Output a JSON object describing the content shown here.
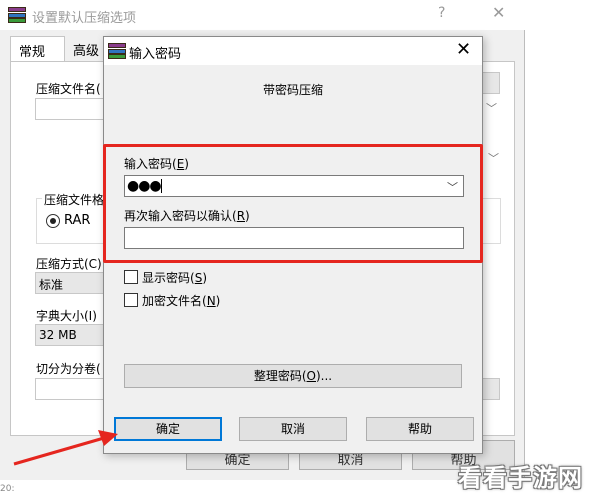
{
  "background_window": {
    "title": "设置默认压缩选项",
    "help_glyph": "?",
    "close_glyph": "✕",
    "tabs": [
      "常规",
      "高级"
    ],
    "archive_name_label": "压缩文件名(",
    "archive_format_label": "压缩文件格",
    "format_option_rar": "RAR",
    "compression_method_label": "压缩方式(C)",
    "compression_method_value": "标准",
    "dictionary_size_label": "字典大小(I)",
    "dictionary_size_value": "32 MB",
    "split_volume_label": "切分为分卷(",
    "buttons": {
      "ok": "确定",
      "cancel": "取消",
      "help": "帮助"
    }
  },
  "dialog": {
    "title": "输入密码",
    "close_glyph": "✕",
    "heading": "带密码压缩",
    "password_label": "输入密码(",
    "password_label_key": "E",
    "password_value": "●●●",
    "confirm_label": "再次输入密码以确认(",
    "confirm_label_key": "R",
    "confirm_value": "",
    "show_password_label": "显示密码(",
    "show_password_key": "S",
    "show_password_checked": false,
    "encrypt_filenames_label": "加密文件名(",
    "encrypt_filenames_key": "N",
    "encrypt_filenames_checked": false,
    "organize_label": "整理密码(",
    "organize_key": "O",
    "organize_suffix": ")...",
    "ok_label": "确定",
    "cancel_label": "取消",
    "help_label": "帮助"
  },
  "watermark": "看看手游网",
  "bottom_strip_text": "20:",
  "colors": {
    "highlight": "#e5261f",
    "focus_blue": "#0078d7"
  }
}
